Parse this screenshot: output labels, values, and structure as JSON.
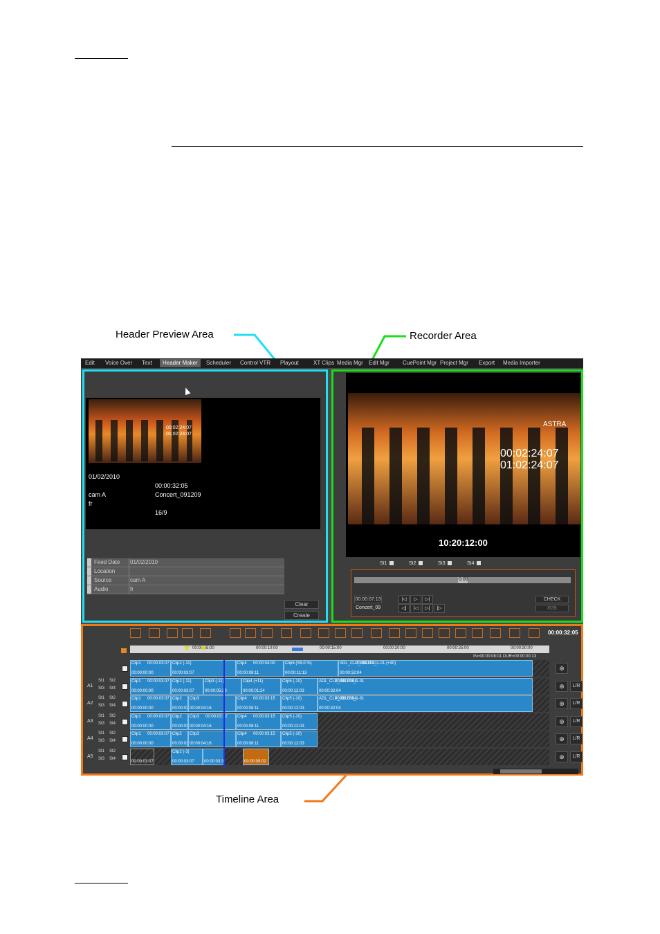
{
  "callouts": {
    "header_preview": "Header Preview Area",
    "recorder": "Recorder Area",
    "timeline": "Timeline Area"
  },
  "colors": {
    "header_preview_frame": "#1ee0f0",
    "recorder_frame": "#17e01a",
    "timeline_frame": "#f07a1a",
    "clip_blue": "#2b88c8"
  },
  "tabs": [
    {
      "label": "Edit"
    },
    {
      "label": "Voice Over"
    },
    {
      "label": "Text"
    },
    {
      "label": "Header Maker",
      "active": true
    },
    {
      "label": "Scheduler"
    },
    {
      "label": "Control VTR"
    },
    {
      "label": "Playout"
    },
    {
      "label": "XT Clips"
    },
    {
      "label": "Media Mgr"
    },
    {
      "label": "Edit Mgr"
    },
    {
      "label": "CuePoint Mgr"
    },
    {
      "label": "Project Mgr"
    },
    {
      "label": "Export"
    },
    {
      "label": "Media Importer"
    }
  ],
  "header_preview": {
    "thumb_tc1": "00:02:24:07",
    "thumb_tc2": "01:02:24:07",
    "date": "01/02/2010",
    "duration": "00:00:32:05",
    "source": "cam A",
    "clip_name": "Concert_091209",
    "audio": "fr",
    "aspect": "16/9",
    "fields": [
      {
        "label": "Feed Date",
        "value": "01/02/2010"
      },
      {
        "label": "Location",
        "value": ""
      },
      {
        "label": "Source",
        "value": "cam A"
      },
      {
        "label": "Audio",
        "value": "fr"
      }
    ],
    "clear_label": "Clear",
    "create_label": "Create"
  },
  "recorder": {
    "video_tc1": "00:02:24:07",
    "video_tc2": "01:02:24:07",
    "logo": "ASTRA",
    "timecode": "10:20:12:00",
    "stills": [
      "St1",
      "St2",
      "St3",
      "St4"
    ],
    "position_value": "0:00",
    "position_fraction": 0.5,
    "current_tc": "00:00:07:13",
    "clip_name": "Concert_09",
    "check_label": "CHECK",
    "r2b_label": "R2B"
  },
  "timeline": {
    "total_tc": "00:00:32:05",
    "in_dur": "IN=00:00:08:01   DUR=00:00:00:13",
    "ruler_labels": [
      "00:00:05:00",
      "00:00:10:00",
      "00:00:15:00",
      "00:00:20:00",
      "00:00:25:00",
      "00:00:30:00"
    ],
    "lr_label": "L/R",
    "tracks": [
      {
        "name": "",
        "clips": [
          {
            "top": "Clip1",
            "tc": "00:00:03:07",
            "bottom": "00:00:00:00"
          },
          {
            "top": "Clip2 (-11)",
            "tc": "",
            "bottom": "00:00:03:07"
          },
          {
            "top": "Clip4",
            "tc": "00:00:04:00",
            "bottom": "00:00:08:11"
          },
          {
            "top": "Clip5 (S9.0 %)",
            "tc": "",
            "bottom": "00:00:11:13"
          },
          {
            "top": "ADL_CLP_091208_1-01 (+40)",
            "tc": "00:00:11:11",
            "bottom": "00:00:32:04"
          }
        ]
      },
      {
        "name": "A1",
        "clips": [
          {
            "top": "Clip1",
            "tc": "00:00:03:07",
            "bottom": "00:00:00:00"
          },
          {
            "top": "Clip2 (-11)",
            "tc": "",
            "bottom": "00:00:03:07"
          },
          {
            "top": "Clip3 (-11)",
            "tc": "",
            "bottom": "00:00:05:20"
          },
          {
            "top": "Clip4 (+11)",
            "tc": "",
            "bottom": "00:00:01:24"
          },
          {
            "top": "Clip5 (-10)",
            "tc": "",
            "bottom": "00:00:12:03"
          },
          {
            "top": "ADL_CLP_091208_1-01",
            "tc": "00:00:17:04",
            "bottom": "00:00:32:04"
          }
        ]
      },
      {
        "name": "A2",
        "clips": [
          {
            "top": "Clip1",
            "tc": "00:00:03:07",
            "bottom": "00:00:00:00"
          },
          {
            "top": "Clip2",
            "tc": "",
            "bottom": "00:00:03:07"
          },
          {
            "top": "Clip3",
            "tc": "",
            "bottom": "00:00:04:16"
          },
          {
            "top": "Clip4",
            "tc": "00:00:03:15",
            "bottom": "00:00:08:11"
          },
          {
            "top": "Clip5 (-10)",
            "tc": "",
            "bottom": "00:00:12:03"
          },
          {
            "top": "ADL_CLP_091208_1-01",
            "tc": "00:00:17:04",
            "bottom": "00:00:32:04"
          }
        ]
      },
      {
        "name": "A3",
        "clips": [
          {
            "top": "Clip1",
            "tc": "00:00:03:07",
            "bottom": "00:00:00:00"
          },
          {
            "top": "Clip2",
            "tc": "",
            "bottom": "00:00:03:07"
          },
          {
            "top": "Clip3",
            "tc": "00:00:03:22",
            "bottom": "00:00:04:16"
          },
          {
            "top": "Clip4",
            "tc": "00:00:03:15",
            "bottom": "00:00:08:11"
          },
          {
            "top": "Clip5 (-10)",
            "tc": "",
            "bottom": "00:00:12:03"
          }
        ]
      },
      {
        "name": "A4",
        "clips": [
          {
            "top": "Clip1",
            "tc": "00:00:03:07",
            "bottom": "00:00:00:00"
          },
          {
            "top": "Clip2",
            "tc": "",
            "bottom": "00:00:03:07"
          },
          {
            "top": "Clip3",
            "tc": "",
            "bottom": "00:00:04:16"
          },
          {
            "top": "Clip4",
            "tc": "00:00:03:15",
            "bottom": "00:00:08:11"
          },
          {
            "top": "Clip5 (-10)",
            "tc": "",
            "bottom": "00:00:12:03"
          }
        ]
      },
      {
        "name": "A5",
        "clips": [
          {
            "top": "",
            "tc": "",
            "bottom": "00:00:03:07"
          },
          {
            "top": "Clip2 (-3)",
            "tc": "",
            "bottom": "00:00:03:07"
          },
          {
            "top": "",
            "tc": "",
            "bottom": "00:00:03:37"
          },
          {
            "top": "",
            "tc": "",
            "bottom": "00:00:09:02"
          }
        ]
      }
    ],
    "track_buttons": [
      "St1",
      "St2",
      "St3",
      "St4"
    ]
  }
}
